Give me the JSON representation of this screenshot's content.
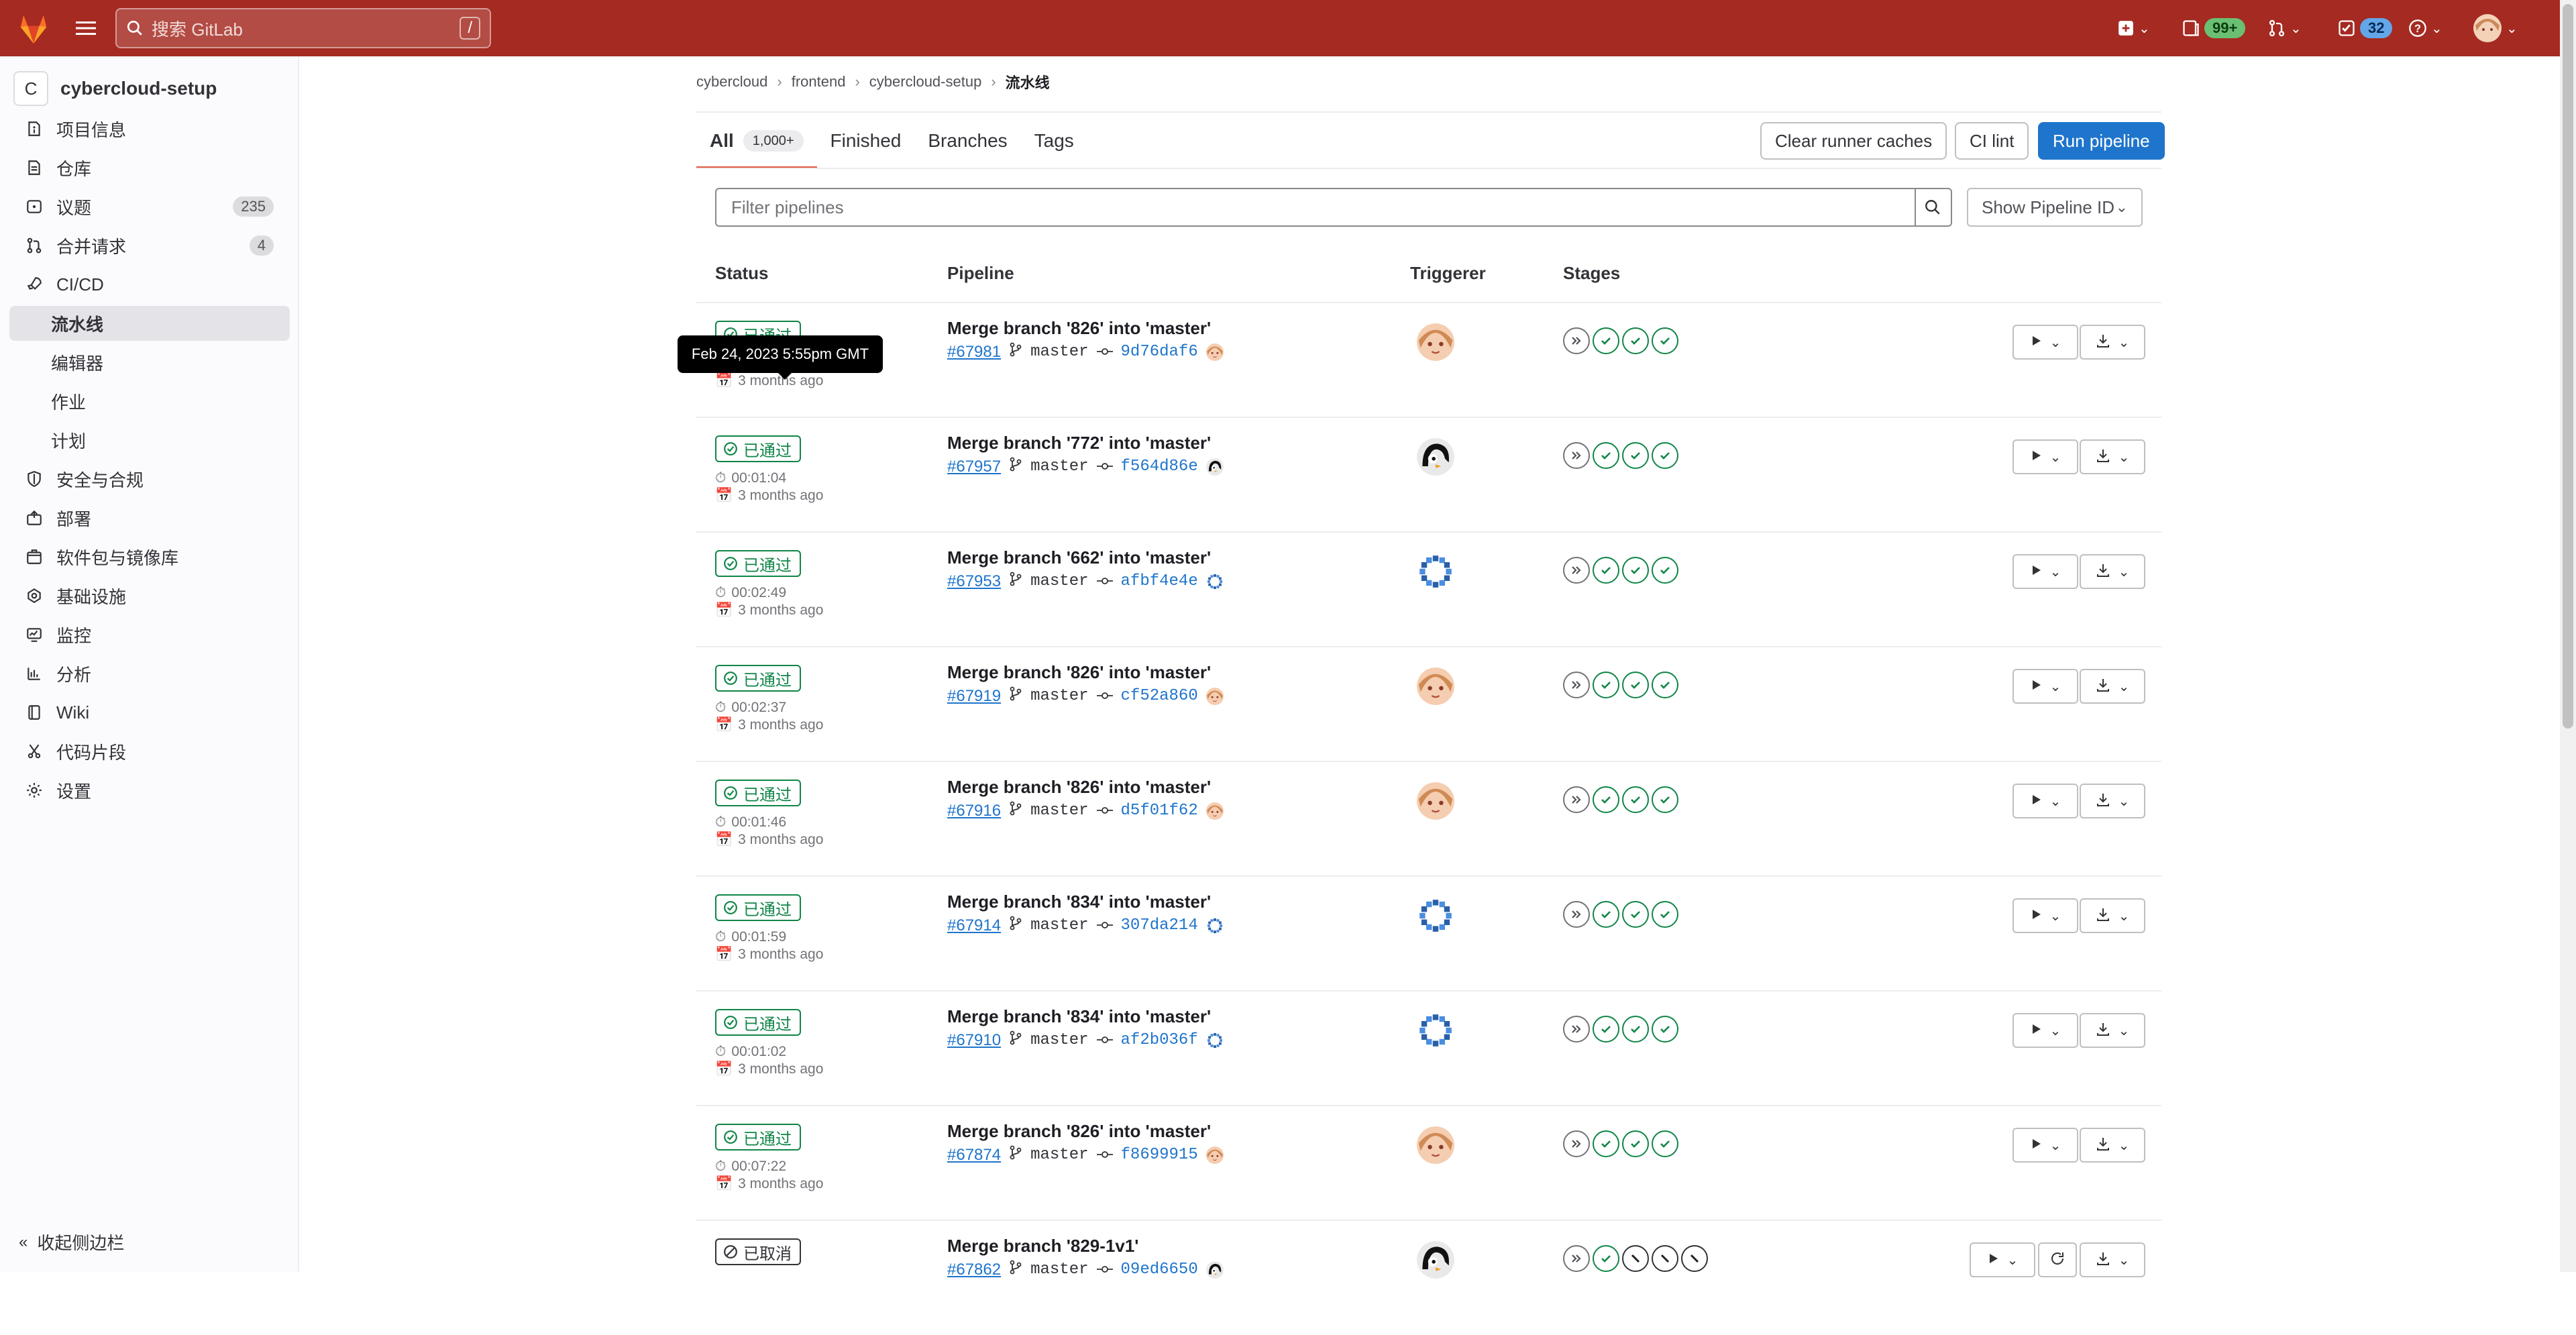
{
  "topbar": {
    "search_placeholder": "搜索 GitLab",
    "search_shortcut": "/",
    "mr_badge": "99+",
    "todo_badge": "32"
  },
  "sidebar": {
    "project_initial": "C",
    "project_name": "cybercloud-setup",
    "items": [
      {
        "label": "项目信息",
        "icon": "info-icon"
      },
      {
        "label": "仓库",
        "icon": "doc-icon"
      },
      {
        "label": "议题",
        "icon": "issues-icon",
        "count": "235"
      },
      {
        "label": "合并请求",
        "icon": "merge-icon",
        "count": "4"
      },
      {
        "label": "CI/CD",
        "icon": "rocket-icon"
      },
      {
        "label": "流水线",
        "sub": true,
        "active": true
      },
      {
        "label": "编辑器",
        "sub": true
      },
      {
        "label": "作业",
        "sub": true
      },
      {
        "label": "计划",
        "sub": true
      },
      {
        "label": "安全与合规",
        "icon": "shield-icon"
      },
      {
        "label": "部署",
        "icon": "deploy-icon"
      },
      {
        "label": "软件包与镜像库",
        "icon": "package-icon"
      },
      {
        "label": "基础设施",
        "icon": "cloud-icon"
      },
      {
        "label": "监控",
        "icon": "monitor-icon"
      },
      {
        "label": "分析",
        "icon": "chart-icon"
      },
      {
        "label": "Wiki",
        "icon": "book-icon"
      },
      {
        "label": "代码片段",
        "icon": "scissors-icon"
      },
      {
        "label": "设置",
        "icon": "gear-icon"
      }
    ],
    "collapse_label": "收起侧边栏"
  },
  "breadcrumb": [
    "cybercloud",
    "frontend",
    "cybercloud-setup",
    "流水线"
  ],
  "tabs": [
    {
      "label": "All",
      "count": "1,000+",
      "active": true
    },
    {
      "label": "Finished"
    },
    {
      "label": "Branches"
    },
    {
      "label": "Tags"
    }
  ],
  "actions": {
    "clear_caches": "Clear runner caches",
    "ci_lint": "CI lint",
    "run_pipeline": "Run pipeline"
  },
  "filter": {
    "placeholder": "Filter pipelines",
    "show_id": "Show Pipeline ID"
  },
  "columns": [
    "Status",
    "Pipeline",
    "Triggerer",
    "Stages"
  ],
  "tooltip": "Feb 24, 2023 5:55pm GMT",
  "pipelines": [
    {
      "status": "已通过",
      "duration": "",
      "ago": "3 months ago",
      "title": "Merge branch '826' into 'master'",
      "id": "#67981",
      "branch": "master",
      "sha": "9d76daf6",
      "avatar": "anime",
      "stages": [
        "skip",
        "success",
        "success",
        "success"
      ]
    },
    {
      "status": "已通过",
      "duration": "00:01:04",
      "ago": "3 months ago",
      "title": "Merge branch '772' into 'master'",
      "id": "#67957",
      "branch": "master",
      "sha": "f564d86e",
      "avatar": "penguin",
      "stages": [
        "skip",
        "success",
        "success",
        "success"
      ]
    },
    {
      "status": "已通过",
      "duration": "00:02:49",
      "ago": "3 months ago",
      "title": "Merge branch '662' into 'master'",
      "id": "#67953",
      "branch": "master",
      "sha": "afbf4e4e",
      "avatar": "pixel",
      "stages": [
        "skip",
        "success",
        "success",
        "success"
      ]
    },
    {
      "status": "已通过",
      "duration": "00:02:37",
      "ago": "3 months ago",
      "title": "Merge branch '826' into 'master'",
      "id": "#67919",
      "branch": "master",
      "sha": "cf52a860",
      "avatar": "anime",
      "stages": [
        "skip",
        "success",
        "success",
        "success"
      ]
    },
    {
      "status": "已通过",
      "duration": "00:01:46",
      "ago": "3 months ago",
      "title": "Merge branch '826' into 'master'",
      "id": "#67916",
      "branch": "master",
      "sha": "d5f01f62",
      "avatar": "anime",
      "stages": [
        "skip",
        "success",
        "success",
        "success"
      ]
    },
    {
      "status": "已通过",
      "duration": "00:01:59",
      "ago": "3 months ago",
      "title": "Merge branch '834' into 'master'",
      "id": "#67914",
      "branch": "master",
      "sha": "307da214",
      "avatar": "pixel",
      "stages": [
        "skip",
        "success",
        "success",
        "success"
      ]
    },
    {
      "status": "已通过",
      "duration": "00:01:02",
      "ago": "3 months ago",
      "title": "Merge branch '834' into 'master'",
      "id": "#67910",
      "branch": "master",
      "sha": "af2b036f",
      "avatar": "pixel",
      "stages": [
        "skip",
        "success",
        "success",
        "success"
      ]
    },
    {
      "status": "已通过",
      "duration": "00:07:22",
      "ago": "3 months ago",
      "title": "Merge branch '826' into 'master'",
      "id": "#67874",
      "branch": "master",
      "sha": "f8699915",
      "avatar": "anime",
      "stages": [
        "skip",
        "success",
        "success",
        "success"
      ]
    },
    {
      "status": "已取消",
      "duration": "",
      "ago": "",
      "title": "Merge branch '829-1v1'",
      "id": "#67862",
      "branch": "master",
      "sha": "09ed6650",
      "avatar": "penguin",
      "stages": [
        "skip",
        "success",
        "canceled",
        "canceled",
        "canceled"
      ],
      "canceled": true
    }
  ],
  "colors": {
    "header": "#a52a21",
    "success": "#108548",
    "link": "#1f75cb",
    "primary": "#1f75cb"
  }
}
